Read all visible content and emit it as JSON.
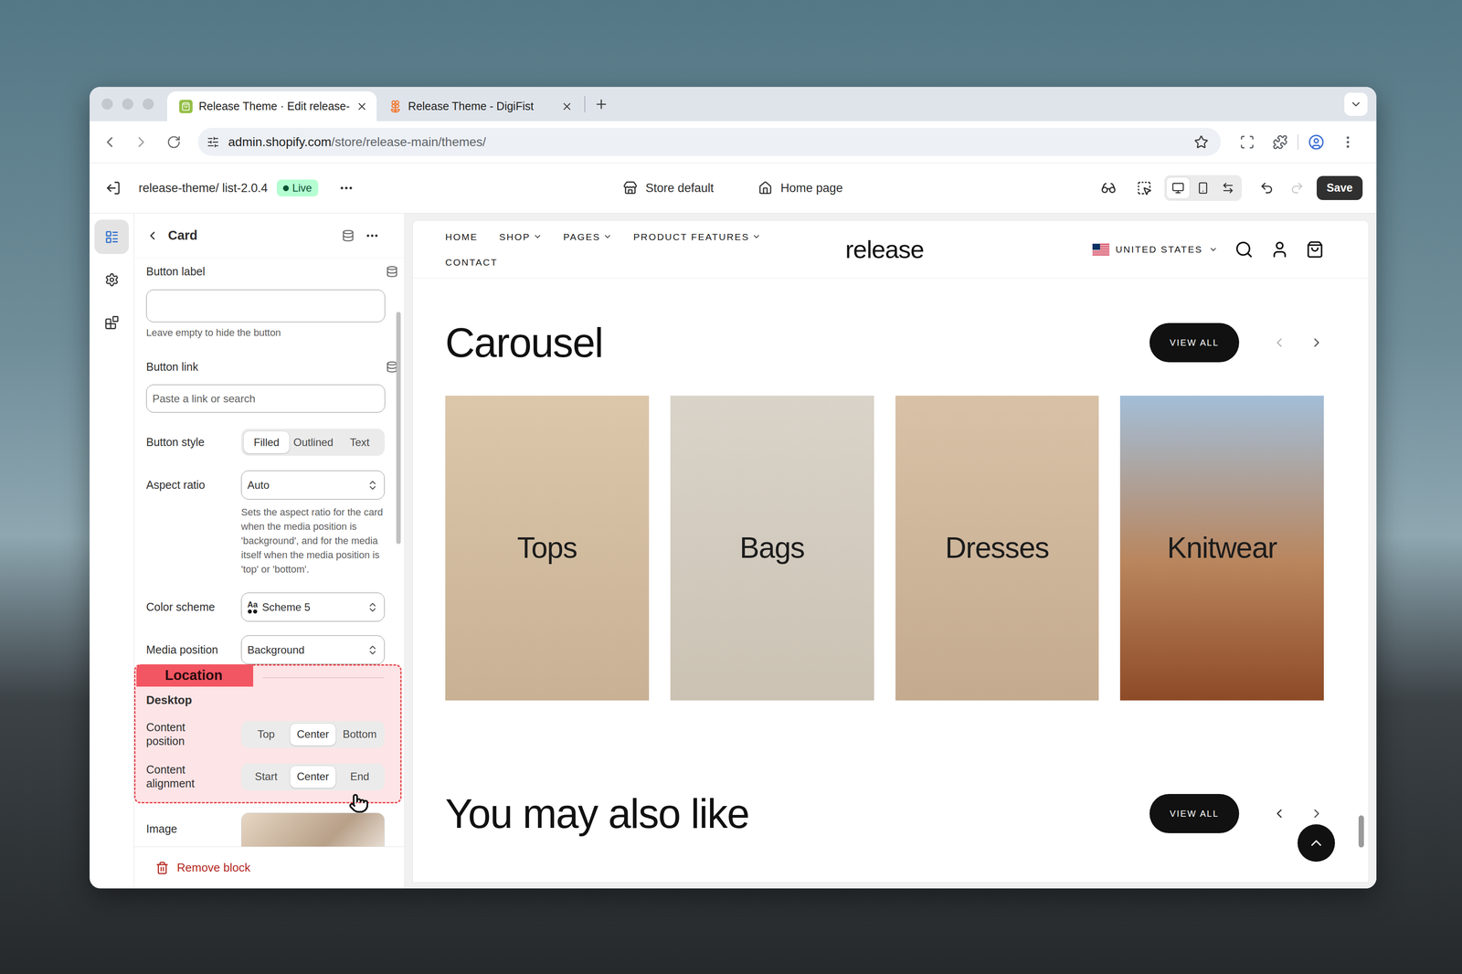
{
  "browser": {
    "tabs": [
      {
        "label": "Release Theme · Edit release-",
        "selected": true,
        "kind": "shopify"
      },
      {
        "label": "Release Theme - DigiFist",
        "selected": false,
        "kind": "digifist"
      }
    ],
    "url_host": "admin.shopify.com",
    "url_path": "/store/release-main/themes/"
  },
  "editor": {
    "theme": "release-theme/ list-2.0.4",
    "status": "Live",
    "store": "Store default",
    "page": "Home page",
    "save": "Save",
    "views": [
      {
        "kind": "desktop",
        "selected": true
      },
      {
        "kind": "mobile",
        "selected": false
      },
      {
        "kind": "fullwidth",
        "selected": false
      }
    ],
    "redo_disabled": true
  },
  "rail": [
    {
      "kind": "sections",
      "selected": true
    },
    {
      "kind": "settings",
      "selected": false
    },
    {
      "kind": "apps",
      "selected": false
    }
  ],
  "panel": {
    "title": "Card",
    "fields": [
      {
        "kind": "text",
        "label": "Button label",
        "value": "",
        "placeholder": "",
        "hint": "Leave empty to hide the button",
        "dynamic_source": true
      },
      {
        "kind": "text",
        "label": "Button link",
        "value": "",
        "placeholder": "Paste a link or search",
        "dynamic_source": true
      },
      {
        "kind": "segmented",
        "label": "Button style",
        "options": [
          {
            "label": "Filled",
            "selected": true
          },
          {
            "label": "Outlined",
            "selected": false
          },
          {
            "label": "Text",
            "selected": false
          }
        ]
      },
      {
        "kind": "select",
        "label": "Aspect ratio",
        "value": "Auto",
        "hint": "Sets the aspect ratio for the card when the media position is 'background', and for the media itself when the media position is 'top' or 'bottom'."
      },
      {
        "kind": "select",
        "label": "Color scheme",
        "value": "Scheme 5",
        "badge": "Aa"
      },
      {
        "kind": "select",
        "label": "Media position",
        "value": "Background"
      }
    ],
    "annotation": "Location",
    "group": {
      "heading": "Desktop",
      "fields": [
        {
          "label": "Content position",
          "options": [
            {
              "label": "Top",
              "selected": false
            },
            {
              "label": "Center",
              "selected": true
            },
            {
              "label": "Bottom",
              "selected": false
            }
          ]
        },
        {
          "label": "Content alignment",
          "options": [
            {
              "label": "Start",
              "selected": false
            },
            {
              "label": "Center",
              "selected": true
            },
            {
              "label": "End",
              "selected": false
            }
          ]
        }
      ]
    },
    "image_label": "Image",
    "remove": "Remove block"
  },
  "preview": {
    "nav": [
      {
        "label": "HOME",
        "dropdown": false
      },
      {
        "label": "SHOP",
        "dropdown": true
      },
      {
        "label": "PAGES",
        "dropdown": true
      },
      {
        "label": "PRODUCT FEATURES",
        "dropdown": true
      },
      {
        "label": "CONTACT",
        "dropdown": false
      }
    ],
    "logo": "release",
    "country": "UNITED STATES",
    "sections": [
      {
        "title": "Carousel",
        "button": "VIEW ALL",
        "prev_disabled": true,
        "cards": [
          "Tops",
          "Bags",
          "Dresses",
          "Knitwear"
        ]
      },
      {
        "title": "You may also like",
        "button": "VIEW ALL",
        "prev_disabled": false
      }
    ]
  }
}
